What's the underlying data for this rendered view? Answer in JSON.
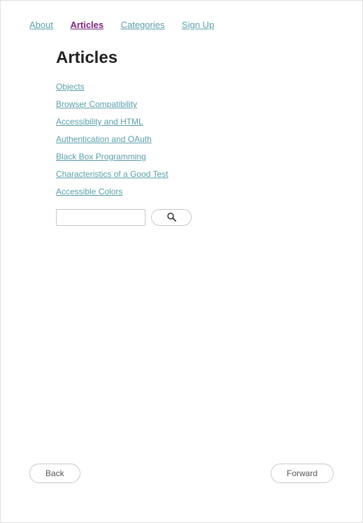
{
  "nav": {
    "items": [
      {
        "label": "About",
        "active": false
      },
      {
        "label": "Articles",
        "active": true
      },
      {
        "label": "Categories",
        "active": false
      },
      {
        "label": "Sign Up",
        "active": false
      }
    ]
  },
  "page": {
    "title": "Articles"
  },
  "articles": [
    {
      "title": "Objects"
    },
    {
      "title": "Browser Compatibility"
    },
    {
      "title": "Accessibility and HTML"
    },
    {
      "title": "Authentication and OAuth"
    },
    {
      "title": "Black Box Programming"
    },
    {
      "title": "Characteristics of a Good Test"
    },
    {
      "title": "Accessible Colors"
    }
  ],
  "buttons": {
    "back": "Back",
    "forward": "Forward"
  }
}
